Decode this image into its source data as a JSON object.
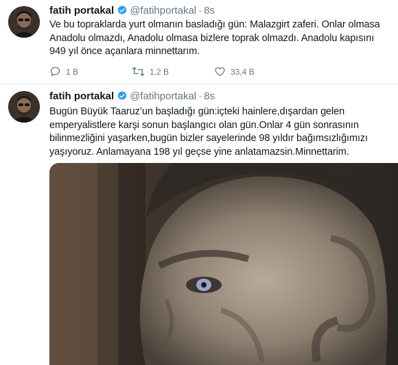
{
  "tweets": [
    {
      "author_name": "fatih portakal",
      "handle": "@fatihportakal",
      "separator": "·",
      "time": "8s",
      "lines": [
        "Ve bu topraklarda yurt olmanın basladığı gün: Malazgirt zaferi. Onlar olmasa",
        "Anadolu olmazdı, Anadolu olmasa bizlere toprak olmazdı. Anadolu kapısını",
        "949 yıl önce açanlara minnettarım."
      ],
      "actions": {
        "reply_count": "1 B",
        "retweet_count": "1,2 B",
        "like_count": "33,4 B"
      }
    },
    {
      "author_name": "fatih portakal",
      "handle": "@fatihportakal",
      "separator": "·",
      "time": "8s",
      "lines": [
        "Bugün Büyük Taaruz’un başladığı gün:içteki hainlere,dışardan gelen",
        "emperyalistlere karşi sonun başlangıcı olan gün.Onlar 4 gün sonrasının",
        "bilinmezliğini yaşarken,bugün bizler sayelerinde 98 yıldır bağımsızlığımızı",
        "yaşıyoruz. Anlamayana 198 yıl geçse yine anlatamazsin.Minnettarim."
      ]
    }
  ],
  "colors": {
    "text": "#14171a",
    "secondary": "#657786",
    "verified": "#1da1f2",
    "divider": "#e1e8ed"
  },
  "icons": [
    "verified-badge-icon",
    "reply-icon",
    "retweet-icon",
    "like-icon"
  ]
}
